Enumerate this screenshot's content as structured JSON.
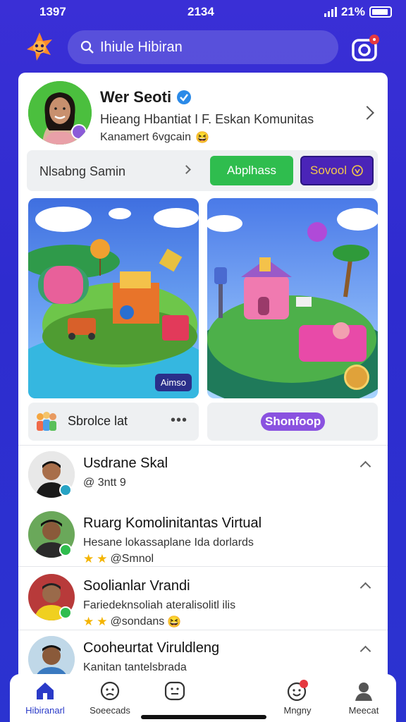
{
  "status_bar": {
    "left": "1397",
    "time": "2134",
    "battery_pct": "21%"
  },
  "search": {
    "placeholder": "Ihiule Hibiran"
  },
  "profile": {
    "name": "Wer Seoti",
    "subtitle": "Hieang Hbantiat I F. Eskan Komunitas",
    "caption": "Kanamert 6vgcain",
    "caption_emoji": "😆"
  },
  "actions": {
    "label": "Nlsabng Samin",
    "green_button": "Abplhass",
    "purple_button": "Sovool"
  },
  "tiles": [
    {
      "tag": "Aimso",
      "footer_label": "Sbrolce lat",
      "more": "•••"
    },
    {
      "footer_pill": "Shonfoop"
    }
  ],
  "list": [
    {
      "title": "Usdrane Skal",
      "sub": "@ 3ntt 9"
    },
    {
      "title": "Ruarg Komolinitantas Virtual",
      "sub": "Hesane lokassaplane Ida dorlards",
      "sub2": "@Smnol"
    },
    {
      "title": "Soolianlar Vrandi",
      "sub": "Fariedeknsoliah ateralisolitl ilis",
      "sub2": "@sondans",
      "sub2_emoji": "😆"
    },
    {
      "title": "Cooheurtat Viruldleng",
      "sub": "Kanitan tantelsbrada"
    }
  ],
  "nav": [
    {
      "label": "Hibiranarl",
      "icon": "home-icon",
      "active": true
    },
    {
      "label": "Soeecads",
      "icon": "face-icon"
    },
    {
      "label": "",
      "icon": "chat-face-icon"
    },
    {
      "label": "Mngny",
      "icon": "smiley-notification-icon"
    },
    {
      "label": "Meecat",
      "icon": "profile-icon"
    }
  ],
  "colors": {
    "accent": "#2e2ccf",
    "green": "#2fbd4e",
    "purple": "#4a24b8",
    "badge_red": "#e53940"
  }
}
